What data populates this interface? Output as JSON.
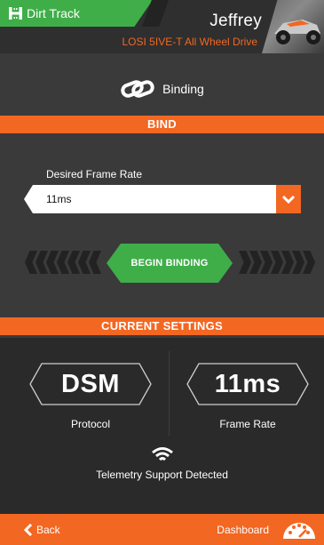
{
  "header": {
    "track_name": "Dirt Track",
    "driver_name": "Jeffrey",
    "vehicle_name": "LOSI 5IVE-T All Wheel Drive"
  },
  "page": {
    "title": "Binding",
    "bind_section": "BIND",
    "frame_rate_label": "Desired Frame Rate",
    "frame_rate_value": "11ms",
    "begin_button": "BEGIN BINDING",
    "current_section": "CURRENT SETTINGS"
  },
  "current_settings": {
    "protocol_value": "DSM",
    "protocol_label": "Protocol",
    "frame_rate_value": "11ms",
    "frame_rate_label": "Frame Rate",
    "telemetry_text": "Telemetry Support Detected"
  },
  "footer": {
    "back_label": "Back",
    "dashboard_label": "Dashboard"
  },
  "colors": {
    "accent_orange": "#f26722",
    "accent_green": "#3fae49",
    "panel": "#3a3a3a",
    "dark": "#2a2a2a"
  },
  "icons": [
    "track-h-icon",
    "vehicle-thumbnail",
    "link-icon",
    "chevron-down-icon",
    "wifi-icon",
    "chevron-left-icon",
    "gauge-icon"
  ]
}
